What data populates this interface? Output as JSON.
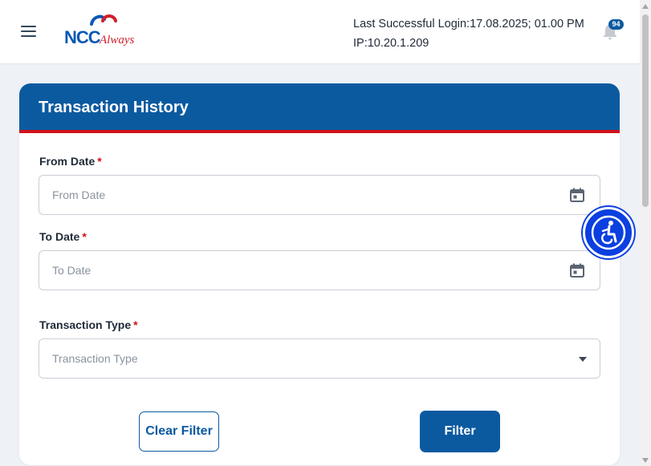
{
  "header": {
    "logo_main": "NCC",
    "logo_script": "Always",
    "last_login_label": "Last Successful Login:",
    "last_login_value": "17.08.2025; 01.00 PM",
    "ip_label": "IP:",
    "ip_value": "10.20.1.209",
    "notification_count": "94"
  },
  "card": {
    "title": "Transaction History",
    "from_date": {
      "label": "From Date",
      "required": "*",
      "placeholder": "From Date"
    },
    "to_date": {
      "label": "To Date",
      "required": "*",
      "placeholder": "To Date"
    },
    "transaction_type": {
      "label": "Transaction Type",
      "required": "*",
      "placeholder": "Transaction Type"
    },
    "clear_filter_label": "Clear Filter",
    "filter_label": "Filter"
  },
  "colors": {
    "primary": "#0b5aa0",
    "accent_red": "#d11219",
    "accessibility": "#0b3fe0"
  },
  "icons": [
    "menu-icon",
    "bell-icon",
    "calendar-icon",
    "dropdown-caret-icon",
    "accessibility-icon"
  ]
}
